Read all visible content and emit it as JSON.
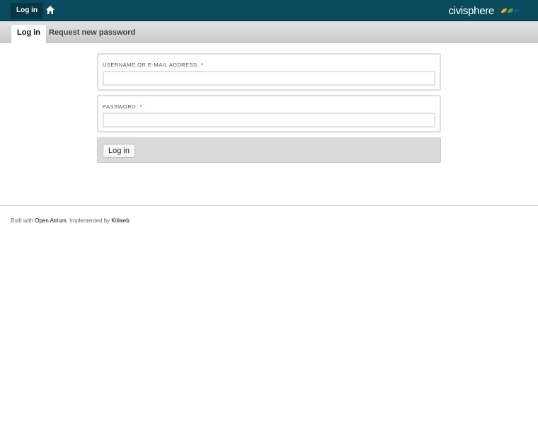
{
  "topbar": {
    "login_label": "Log in",
    "logo": "civisphere",
    "logo_colors": [
      "#f5a01a",
      "#4fa82a",
      "#1e4e8c"
    ]
  },
  "tabs": [
    {
      "label": "Log in",
      "active": true
    },
    {
      "label": "Request new password",
      "active": false
    }
  ],
  "form": {
    "username_label": "USERNAME OR E-MAIL ADDRESS:",
    "password_label": "PASSWORD:",
    "required_mark": "*",
    "username_value": "",
    "password_value": "",
    "submit_label": "Log in"
  },
  "footer": {
    "prefix": "Built with ",
    "link1": "Open Atrium",
    "middle": ". Implemented by ",
    "link2": "Kiliweb"
  }
}
